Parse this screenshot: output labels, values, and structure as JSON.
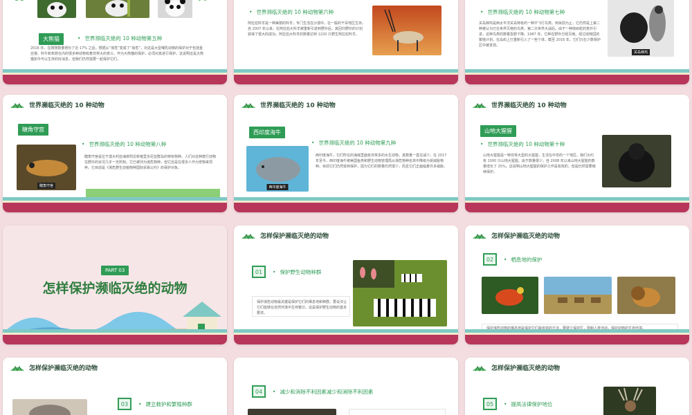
{
  "section_header": "世界濒临灭绝的 10 种动物",
  "protect_header": "怎样保护濒临灭绝的动物",
  "slides": {
    "panda": {
      "tag": "大熊猫",
      "bullet": "世界濒临灭绝的 10 种动物第五种",
      "paragraph": "2016 年，在刚刚数量增长了近 17% 之后，根据从“濒危”变成了“易危”，对这是大型哺乳动物的保护对于包括金丝猴、羚牛和朱鹮在内的很多种动物有着非常大的意义。作为大熊猫的保护，必须对其进行保护。这说明这是大熊猫如今可以生存的好消息，但我们仍然需要一起保护它们。"
    },
    "oryx": {
      "bullet": "世界濒临灭绝的 10 种动物第六种",
      "paragraph": "阿拉伯羚羊是一种美丽的羚羊，专门生活在沙漠中。在一般的干旱地区生存。自 2007 年以来，在阿拉伯大羚羊被重新引进到野外后，其回归野外的计划获得了很大的成功。阿拉伯大羚羊的数量达到 1220 只野生阿拉伯羚羊。"
    },
    "rail": {
      "bullet": "世界濒临灭绝的 10 种动物第七种",
      "paragraph": "关岛秧鸡是西太平洋关岛特有的一种不飞行鸟类。到目前为止，它仍然是上第二种被认为已在世界灭绝的鸟类。第二次世界大战后，由于一种棕树蛇的意外引进，这种鸟类的数量急剧下降。1987 年，它种在野外已经灭绝。经过动物园的繁殖计划，在岛屿上已重新引入了一些个体，截至 2016 年，它们只在少数保护区中被发现。",
      "caption": "关岛秧鸡"
    },
    "gecko": {
      "tag": "睫角守宫",
      "bullet": "世界濒临灭绝的 10 种动物第八种",
      "paragraph": "睫角守宫是位于澳大利亚海岸附近新喀里多尼亚群岛的特有物种，人们对这种爬行动物在野外的状况几乎一无所知。它已被列为濒危物种，但它还是在很多人作为宠物来饲养。它目前是《濒危野生动植物种国际贸易公约》的保护对象。",
      "caption": "睫角守宫"
    },
    "manatee": {
      "tag": "西印度海牛",
      "bullet": "世界濒临灭绝的 10 种动物第九种",
      "paragraph": "西印度海牛，它们所在的海域里面有非常多的水生动物，其数量一直在减少。在 2017 年至今，西印度海牛被美国鱼类和野生动物管理局从濒危物种名单中降级为受威胁物种。目前它们仍然受到保护，因为它们的数量仍然很少，而且它们正面临着许多威胁。",
      "caption": "西印度海牛"
    },
    "gorilla": {
      "tag": "山地大猩猩",
      "bullet": "世界濒临灭绝的 10 种动物第十种",
      "paragraph": "山地大猩猩是一种非常大型的大猩猩，生活在中非的一个地区。我们大约有 1000 只山地大猩猩。由于数量很少，自 2008 年以来山地大猩猩的数量增长了 25%。这说明山地大猩猩的保护工作是有效的，但是仍然需要继续保护。"
    },
    "part3": {
      "badge": "PART 03",
      "title": "怎样保护濒临灭绝的动物"
    },
    "s01": {
      "num": "01",
      "bullet": "保护野生动物种群",
      "paragraph": "保护濒危动物最关键是保护它们的栖息地和种群。要设法让它们能够在自然环境中生存繁衍，这是保护野生动物的基本要求。"
    },
    "s02": {
      "num": "02",
      "bullet": "栖息地的保护",
      "paragraph": "保护濒危动物的栖息地是保护它们最有效的方法，要建立保护区，限制人类活动，保护动物的生存环境。"
    },
    "s03": {
      "num": "03",
      "bullet": "建立救护和繁殖种群"
    },
    "s04": {
      "num": "04",
      "bullet": "减少和消除不利因素减少和消除不利因素"
    },
    "s05": {
      "num": "05",
      "bullet": "提高法律保护地位"
    }
  },
  "colors": {
    "accent": "#2f9c56",
    "background": "#f4dde0",
    "stripe_red": "#b7365a",
    "stripe_teal": "#7fc9c4"
  }
}
